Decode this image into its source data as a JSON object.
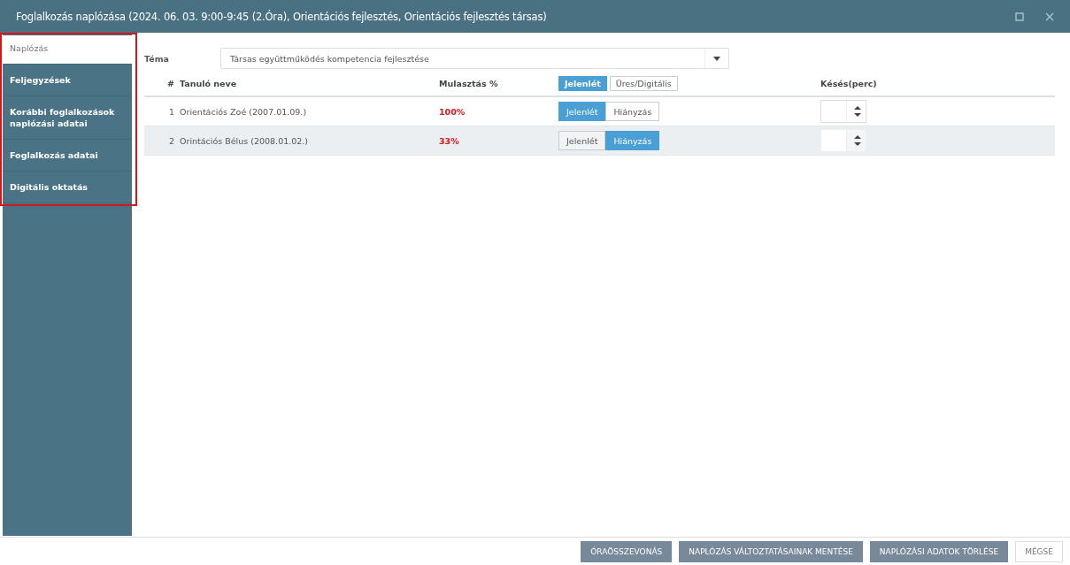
{
  "window": {
    "title": "Foglalkozás naplózása (2024. 06. 03. 9:00-9:45 (2.Óra), Orientációs fejlesztés, Orientációs fejlesztés társas)"
  },
  "sidebar": {
    "highlighted": true,
    "items": [
      {
        "label": "Naplózás",
        "selected": true
      },
      {
        "label": "Feljegyzések",
        "selected": false
      },
      {
        "label": "Korábbi foglalkozások naplózási adatai",
        "selected": false
      },
      {
        "label": "Foglalkozás adatai",
        "selected": false
      },
      {
        "label": "Digitális oktatás",
        "selected": false
      }
    ]
  },
  "topic": {
    "label": "Téma",
    "value": "Társas együttműködés kompetencia fejlesztése"
  },
  "table": {
    "columns": {
      "number": "#",
      "name": "Tanuló neve",
      "absence": "Mulasztás %",
      "late": "Késés(perc)"
    },
    "bulk_toggle": [
      {
        "label": "Jelenlét",
        "selected": true
      },
      {
        "label": "Üres/Digitális",
        "selected": false
      }
    ],
    "rows": [
      {
        "number": "1",
        "name": "Orientációs Zoé (2007.01.09.)",
        "absence": "100%",
        "highlighted": false,
        "attendance": [
          {
            "label": "Jelenlét",
            "selected": true
          },
          {
            "label": "Hiányzás",
            "selected": false
          }
        ]
      },
      {
        "number": "2",
        "name": "Orintációs Bélus (2008.01.02.)",
        "absence": "33%",
        "highlighted": true,
        "attendance": [
          {
            "label": "Jelenlét",
            "selected": false
          },
          {
            "label": "Hiányzás",
            "selected": true
          }
        ]
      }
    ]
  },
  "footer": {
    "buttons": [
      {
        "label": "ÓRAÖSSZEVONÁS",
        "kind": "primary"
      },
      {
        "label": "NAPLÓZÁS VÁLTOZTATÁSAINAK MENTÉSE",
        "kind": "primary"
      },
      {
        "label": "NAPLÓZÁSI ADATOK TÖRLÉSE",
        "kind": "primary"
      },
      {
        "label": "MÉGSE",
        "kind": "secondary"
      }
    ]
  }
}
